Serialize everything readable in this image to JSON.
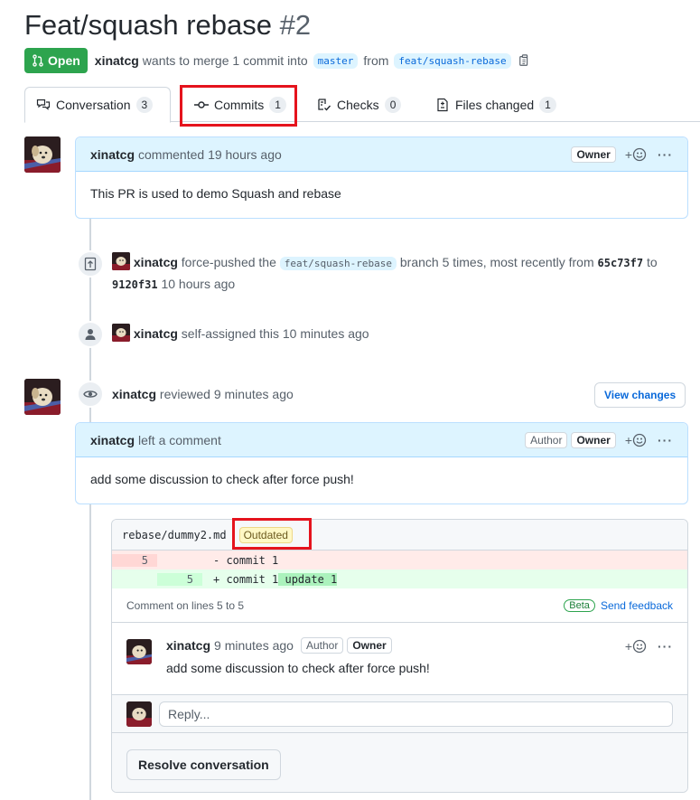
{
  "pr": {
    "title": "Feat/squash rebase",
    "number": "#2",
    "state": "Open",
    "author": "xinatcg",
    "merge_text": "wants to merge 1 commit into",
    "base_branch": "master",
    "from_text": "from",
    "head_branch": "feat/squash-rebase"
  },
  "tabs": [
    {
      "label": "Conversation",
      "count": "3",
      "icon": "comment-discussion-icon"
    },
    {
      "label": "Commits",
      "count": "1",
      "icon": "git-commit-icon"
    },
    {
      "label": "Checks",
      "count": "0",
      "icon": "checklist-icon"
    },
    {
      "label": "Files changed",
      "count": "1",
      "icon": "file-diff-icon"
    }
  ],
  "first_comment": {
    "author": "xinatcg",
    "action": "commented",
    "time": "19 hours ago",
    "role": "Owner",
    "react": "+",
    "body": "This PR is used to demo Squash and rebase"
  },
  "events": {
    "force_push": {
      "author": "xinatcg",
      "pre": "force-pushed the",
      "branch": "feat/squash-rebase",
      "mid": "branch 5 times, most recently from",
      "from_sha": "65c73f7",
      "to_text": "to",
      "to_sha": "9120f31",
      "time": "10 hours ago"
    },
    "assign": {
      "author": "xinatcg",
      "action": "self-assigned this",
      "time": "10 minutes ago"
    },
    "review": {
      "author": "xinatcg",
      "action": "reviewed",
      "time": "9 minutes ago",
      "button": "View changes"
    }
  },
  "review_comment": {
    "author": "xinatcg",
    "action": "left a comment",
    "role_author": "Author",
    "role_owner": "Owner",
    "body": "add some discussion to check after force push!"
  },
  "thread": {
    "file": "rebase/dummy2.md",
    "outdated": "Outdated",
    "diff": [
      {
        "type": "del",
        "old": "5",
        "new": "",
        "code": "- commit 1",
        "hl": ""
      },
      {
        "type": "add",
        "old": "",
        "new": "5",
        "code": "+ commit 1",
        "hl": " update 1"
      }
    ],
    "lines_note": "Comment on lines 5 to 5",
    "beta": "Beta",
    "feedback": "Send feedback",
    "comment": {
      "author": "xinatcg",
      "time": "9 minutes ago",
      "role_author": "Author",
      "role_owner": "Owner",
      "body": "add some discussion to check after force push!"
    },
    "reply_placeholder": "Reply...",
    "resolve": "Resolve conversation"
  },
  "colors": {
    "open_green": "#2da44e",
    "link_blue": "#0969da",
    "highlight_red": "#e5131d"
  }
}
